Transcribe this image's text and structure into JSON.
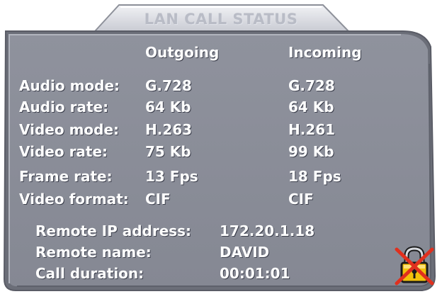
{
  "window": {
    "title": "LAN CALL STATUS"
  },
  "columns": {
    "outgoing": "Outgoing",
    "incoming": "Incoming"
  },
  "stats": [
    {
      "label": "Audio mode:",
      "outgoing": "G.728",
      "incoming": "G.728"
    },
    {
      "label": "Audio rate:",
      "outgoing": "64 Kb",
      "incoming": "64 Kb"
    },
    {
      "label": "Video mode:",
      "outgoing": "H.263",
      "incoming": "H.261"
    },
    {
      "label": "Video rate:",
      "outgoing": "75 Kb",
      "incoming": "99 Kb"
    },
    {
      "label": "Frame rate:",
      "outgoing": "13 Fps",
      "incoming": "18 Fps"
    },
    {
      "label": "Video format:",
      "outgoing": "CIF",
      "incoming": "CIF"
    }
  ],
  "summary": [
    {
      "label": "Remote IP address:",
      "value": "172.20.1.18"
    },
    {
      "label": "Remote name:",
      "value": "DAVID"
    },
    {
      "label": "Call duration:",
      "value": "00:01:01"
    }
  ],
  "icons": {
    "status_icon": "lock-icon-crossed-out"
  },
  "colors": {
    "panel": "#898c97",
    "text": "#ffffff",
    "title_text": "#b9bcc6",
    "cross": "#e0301e",
    "lock_body": "#f2c10b"
  }
}
